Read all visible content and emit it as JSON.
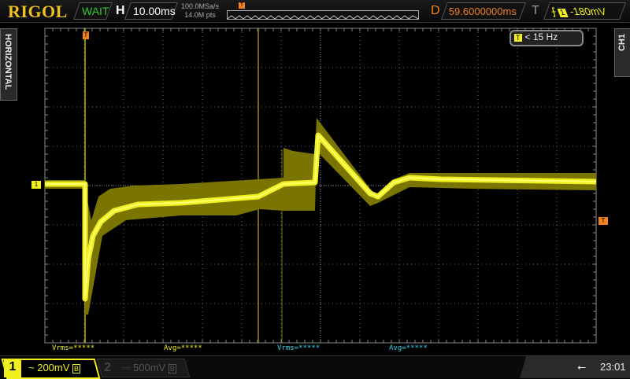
{
  "header": {
    "brand": "RIGOL",
    "run_status": "WAIT",
    "timebase_label": "H",
    "timebase": "10.00ms",
    "sample_rate": "100.0MSa/s",
    "memory_depth": "14.0M pts",
    "delay_label": "D",
    "delay": "59.6000000ms",
    "trigger_label": "T",
    "trigger_channel": "1",
    "trigger_level": "-180mV",
    "trigger_marker": "T"
  },
  "side": {
    "left_tab": "HORIZONTAL",
    "right_tab": "CH1"
  },
  "plot": {
    "trigger_freq_badge": "T",
    "trigger_freq": "< 15 Hz",
    "ch1_marker": "1",
    "trigger_level_marker": "T"
  },
  "measurements": [
    {
      "label": "Vrms=*****",
      "color": "#f0f020"
    },
    {
      "label": "Avg=*****",
      "color": "#f0f020"
    },
    {
      "label": "Vrms=*****",
      "color": "#30d8f0"
    },
    {
      "label": "Avg=*****",
      "color": "#30d8f0"
    }
  ],
  "channels": [
    {
      "num": "1",
      "coupling": "~",
      "scale": "200mV",
      "bw": "B",
      "active": true
    },
    {
      "num": "2",
      "coupling": "⎓",
      "scale": "500mV",
      "bw": "B",
      "active": false
    }
  ],
  "status": {
    "time": "23:01",
    "usb_icon": "usb-icon"
  },
  "colors": {
    "ch1": "#f0f020",
    "ch2": "#30d8f0",
    "accent": "#f08020"
  }
}
